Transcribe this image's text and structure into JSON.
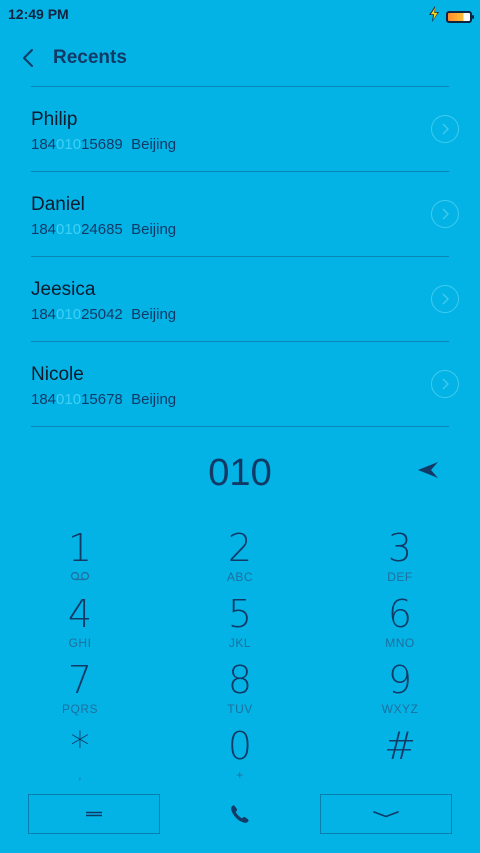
{
  "status_bar": {
    "time": "12:49 PM",
    "icons": [
      "charging-bolt-icon",
      "battery-icon"
    ]
  },
  "header": {
    "back_icon": "chevron-left-icon",
    "title": "Recents"
  },
  "recents": [
    {
      "name": "Philip",
      "number_prefix": "184",
      "number_match": "010",
      "number_suffix": "15689",
      "location": "Beijing"
    },
    {
      "name": "Daniel",
      "number_prefix": "184",
      "number_match": "010",
      "number_suffix": "24685",
      "location": "Beijing"
    },
    {
      "name": "Jeesica",
      "number_prefix": "184",
      "number_match": "010",
      "number_suffix": "25042",
      "location": "Beijing"
    },
    {
      "name": "Nicole",
      "number_prefix": "184",
      "number_match": "010",
      "number_suffix": "15678",
      "location": "Beijing"
    }
  ],
  "dialer": {
    "input": "010",
    "backspace_icon": "backspace-arrow-icon"
  },
  "keypad": [
    {
      "digit": "1",
      "letters": ""
    },
    {
      "digit": "2",
      "letters": "ABC"
    },
    {
      "digit": "3",
      "letters": "DEF"
    },
    {
      "digit": "4",
      "letters": "GHI"
    },
    {
      "digit": "5",
      "letters": "JKL"
    },
    {
      "digit": "6",
      "letters": "MNO"
    },
    {
      "digit": "7",
      "letters": "PQRS"
    },
    {
      "digit": "8",
      "letters": "TUV"
    },
    {
      "digit": "9",
      "letters": "WXYZ"
    },
    {
      "digit": "*",
      "letters": ","
    },
    {
      "digit": "0",
      "letters": "+"
    },
    {
      "digit": "#",
      "letters": ""
    }
  ],
  "bottom_bar": {
    "menu_icon": "menu-icon",
    "call_icon": "phone-icon",
    "collapse_icon": "chevron-down-icon"
  },
  "colors": {
    "background": "#03b3e6",
    "text": "#123a66",
    "highlight": "#3fd0f5",
    "divider": "#0a86b5"
  }
}
